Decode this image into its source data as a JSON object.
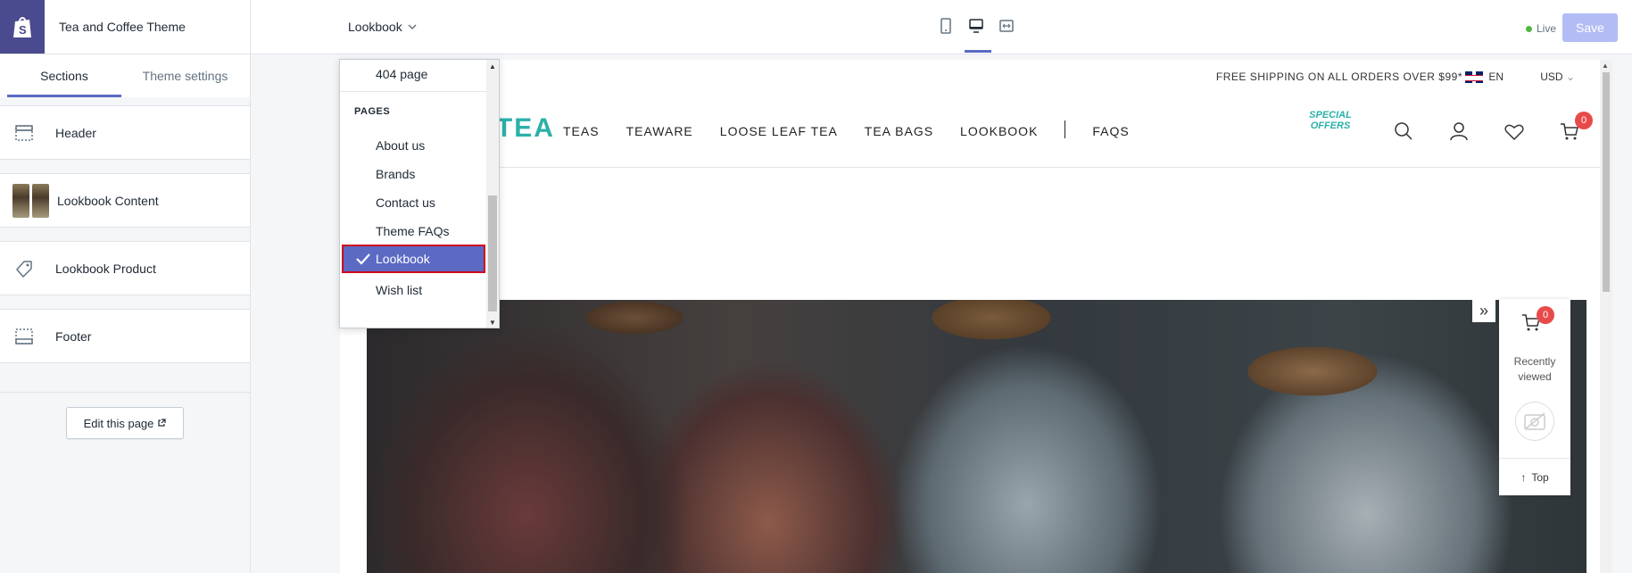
{
  "topbar": {
    "theme_name": "Tea and Coffee Theme",
    "page_selector": "Lookbook",
    "live_label": "Live",
    "save_label": "Save"
  },
  "sidebar": {
    "tabs": [
      {
        "label": "Sections"
      },
      {
        "label": "Theme settings"
      }
    ],
    "sections": [
      {
        "label": "Header",
        "icon": "header-icon"
      },
      {
        "label": "Lookbook Content",
        "icon": "image-thumbnails"
      },
      {
        "label": "Lookbook Product",
        "icon": "tag-icon"
      },
      {
        "label": "Footer",
        "icon": "footer-icon"
      }
    ],
    "edit_page_label": "Edit this page"
  },
  "dropdown": {
    "items_top": [
      {
        "label": "404 page"
      }
    ],
    "group_label": "PAGES",
    "items": [
      {
        "label": "About us"
      },
      {
        "label": "Brands"
      },
      {
        "label": "Contact us"
      },
      {
        "label": "Theme FAQs"
      },
      {
        "label": "Lookbook",
        "selected": true
      },
      {
        "label": "Wish list"
      }
    ]
  },
  "preview": {
    "shipping_text": "FREE SHIPPING ON ALL ORDERS OVER $99*",
    "language": "EN",
    "currency": "USD",
    "brand": "EA TEA",
    "nav": [
      "TEAS",
      "TEAWARE",
      "LOOSE LEAF TEA",
      "TEA BAGS",
      "LOOKBOOK",
      "FAQS"
    ],
    "special_offers": "SPECIAL OFFERS",
    "cart_count": "0",
    "recently_viewed": {
      "cart_count": "0",
      "label": "Recently viewed",
      "top_label": "Top"
    }
  },
  "colors": {
    "accent": "#5c6ac4",
    "brand_teal": "#2bb0a9",
    "badge_red": "#e84a4a",
    "selection_border": "#d0021b"
  }
}
